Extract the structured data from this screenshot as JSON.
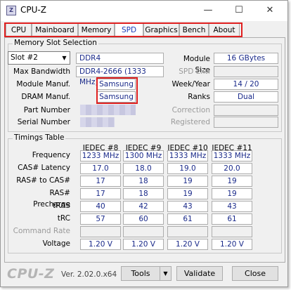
{
  "window": {
    "title": "CPU-Z",
    "app_icon": "cpuz-icon",
    "minimize": "—",
    "maximize": "☐",
    "close": "✕"
  },
  "tabs": [
    "CPU",
    "Mainboard",
    "Memory",
    "SPD",
    "Graphics",
    "Bench",
    "About"
  ],
  "active_tab": "SPD",
  "memory_slot": {
    "group_title": "Memory Slot Selection",
    "slot": "Slot #2",
    "module_type": "DDR4",
    "labels": {
      "max_bandwidth": "Max Bandwidth",
      "module_manuf": "Module Manuf.",
      "dram_manuf": "DRAM Manuf.",
      "part_number": "Part Number",
      "serial_number": "Serial Number",
      "module_size": "Module Size",
      "spd_ext": "SPD Ext.",
      "week_year": "Week/Year",
      "ranks": "Ranks",
      "correction": "Correction",
      "registered": "Registered"
    },
    "values": {
      "max_bandwidth": "DDR4-2666 (1333 MHz)",
      "module_manuf": "Samsung",
      "dram_manuf": "Samsung",
      "module_size": "16 GBytes",
      "week_year": "14 / 20",
      "ranks": "Dual"
    }
  },
  "timings": {
    "group_title": "Timings Table",
    "columns": [
      "JEDEC #8",
      "JEDEC #9",
      "JEDEC #10",
      "JEDEC #11"
    ],
    "rows": [
      {
        "label": "Frequency",
        "values": [
          "1233 MHz",
          "1300 MHz",
          "1333 MHz",
          "1333 MHz"
        ]
      },
      {
        "label": "CAS# Latency",
        "values": [
          "17.0",
          "18.0",
          "19.0",
          "20.0"
        ]
      },
      {
        "label": "RAS# to CAS#",
        "values": [
          "17",
          "18",
          "19",
          "19"
        ]
      },
      {
        "label": "RAS# Precharge",
        "values": [
          "17",
          "18",
          "19",
          "19"
        ]
      },
      {
        "label": "tRAS",
        "values": [
          "40",
          "42",
          "43",
          "43"
        ]
      },
      {
        "label": "tRC",
        "values": [
          "57",
          "60",
          "61",
          "61"
        ]
      },
      {
        "label": "Command Rate",
        "values": [
          "",
          "",
          "",
          ""
        ]
      },
      {
        "label": "Voltage",
        "values": [
          "1.20 V",
          "1.20 V",
          "1.20 V",
          "1.20 V"
        ]
      }
    ]
  },
  "footer": {
    "logo": "CPU-Z",
    "version": "Ver. 2.02.0.x64",
    "tools_label": "Tools",
    "validate_label": "Validate",
    "close_label": "Close"
  },
  "colors": {
    "value_text": "#1a2a8a",
    "highlight_border": "#e02020",
    "active_tab_text": "#1a3ab8"
  }
}
